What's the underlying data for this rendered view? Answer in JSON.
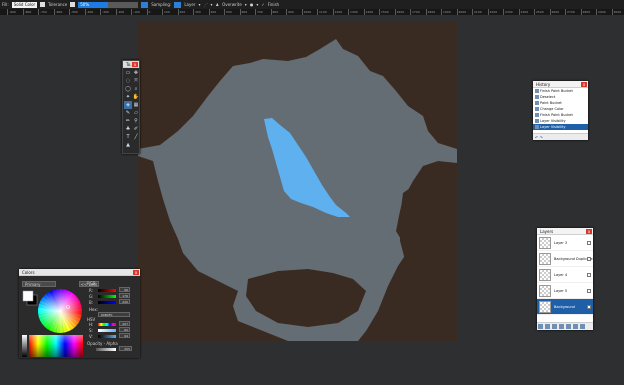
{
  "toolbar": {
    "fill_label": "Fill:",
    "fill_value": "Solid Color",
    "tolerance_label": "Tolerance",
    "tolerance_value": "50%",
    "tolerance_percent": 50,
    "sampling_label": "Sampling:",
    "sampling_value": "Layer",
    "blend_label": "Overwrite",
    "finish_label": "Finish"
  },
  "ruler": {
    "ticks": [
      "-900",
      "-800",
      "-700",
      "-600",
      "-500",
      "-400",
      "-300",
      "-200",
      "-100",
      "0",
      "100",
      "200",
      "300",
      "400",
      "500",
      "600",
      "700",
      "800",
      "900",
      "1000",
      "1100",
      "1200",
      "1300",
      "1400",
      "1500",
      "1600",
      "1700",
      "1800",
      "1900",
      "2000",
      "2100",
      "2200",
      "2300",
      "2400",
      "2500",
      "2600",
      "2700",
      "2800",
      "2900",
      "3000"
    ]
  },
  "tools_panel": {
    "title": "To...",
    "close": "x"
  },
  "history": {
    "title": "History",
    "close": "x",
    "items": [
      {
        "label": "Finish Paint Bucket",
        "selected": false
      },
      {
        "label": "Deselect",
        "selected": false
      },
      {
        "label": "Paint Bucket",
        "selected": false
      },
      {
        "label": "Change Color",
        "selected": false
      },
      {
        "label": "Finish Paint Bucket",
        "selected": false
      },
      {
        "label": "Layer Visibility",
        "selected": false
      },
      {
        "label": "Layer Visibility",
        "selected": true
      }
    ]
  },
  "layers": {
    "title": "Layers",
    "close": "x",
    "items": [
      {
        "label": "Layer 3",
        "selected": false
      },
      {
        "label": "Background Duplicate",
        "selected": false
      },
      {
        "label": "Layer 4",
        "selected": false
      },
      {
        "label": "Layer 5",
        "selected": false
      },
      {
        "label": "Background",
        "selected": true
      }
    ]
  },
  "colors": {
    "title": "Colors",
    "close": "x",
    "primary_select": "Primary",
    "less_button": "<< Less",
    "rgb_label": "RGB",
    "r_label": "R:",
    "r_value": "96",
    "g_label": "G:",
    "g_value": "176",
    "b_label": "B:",
    "b_value": "240",
    "hex_label": "Hex:",
    "hex_value": "60B0F0",
    "hsv_label": "HSV",
    "h_label": "H:",
    "h_value": "207",
    "s_label": "S:",
    "s_value": "60",
    "v_label": "V:",
    "v_value": "94",
    "opacity_label": "Opacity - Alpha",
    "alpha_value": "255"
  },
  "palette": {
    "background": "#2e2f31",
    "canvas_dark": "#3a2b22",
    "land_gray": "#656d74",
    "water_blue": "#5fb0ef"
  }
}
